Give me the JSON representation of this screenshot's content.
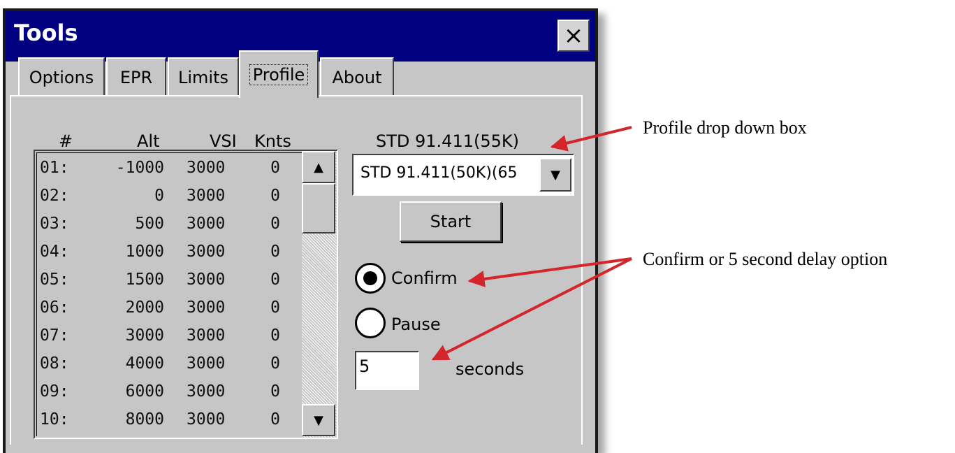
{
  "window": {
    "title": "Tools",
    "close_label": "×"
  },
  "tabs": [
    {
      "label": "Options"
    },
    {
      "label": "EPR"
    },
    {
      "label": "Limits"
    },
    {
      "label": "Profile",
      "active": true
    },
    {
      "label": "About"
    }
  ],
  "list": {
    "headers": {
      "num": "#",
      "alt": "Alt",
      "vsi": "VSI",
      "knts": "Knts"
    },
    "rows": [
      {
        "num": "01:",
        "alt": "-1000",
        "vsi": "3000",
        "knts": "0"
      },
      {
        "num": "02:",
        "alt": "0",
        "vsi": "3000",
        "knts": "0"
      },
      {
        "num": "03:",
        "alt": "500",
        "vsi": "3000",
        "knts": "0"
      },
      {
        "num": "04:",
        "alt": "1000",
        "vsi": "3000",
        "knts": "0"
      },
      {
        "num": "05:",
        "alt": "1500",
        "vsi": "3000",
        "knts": "0"
      },
      {
        "num": "06:",
        "alt": "2000",
        "vsi": "3000",
        "knts": "0"
      },
      {
        "num": "07:",
        "alt": "3000",
        "vsi": "3000",
        "knts": "0"
      },
      {
        "num": "08:",
        "alt": "4000",
        "vsi": "3000",
        "knts": "0"
      },
      {
        "num": "09:",
        "alt": "6000",
        "vsi": "3000",
        "knts": "0"
      },
      {
        "num": "10:",
        "alt": "8000",
        "vsi": "3000",
        "knts": "0"
      }
    ],
    "scroll_up": "▲",
    "scroll_down": "▼"
  },
  "profile": {
    "current_label": "STD 91.411(55K)",
    "selected": "STD 91.411(50K)(65",
    "dropdown_arrow": "▼",
    "start_label": "Start"
  },
  "mode": {
    "confirm_label": "Confirm",
    "pause_label": "Pause",
    "selected": "confirm",
    "seconds_value": "5",
    "seconds_label": "seconds"
  },
  "annotations": {
    "profile_dropdown": "Profile drop down box",
    "confirm_delay": "Confirm or 5 second delay option"
  },
  "colors": {
    "titlebar": "#000080",
    "window_bg": "#c6c6c6",
    "arrow": "#d4252a"
  }
}
